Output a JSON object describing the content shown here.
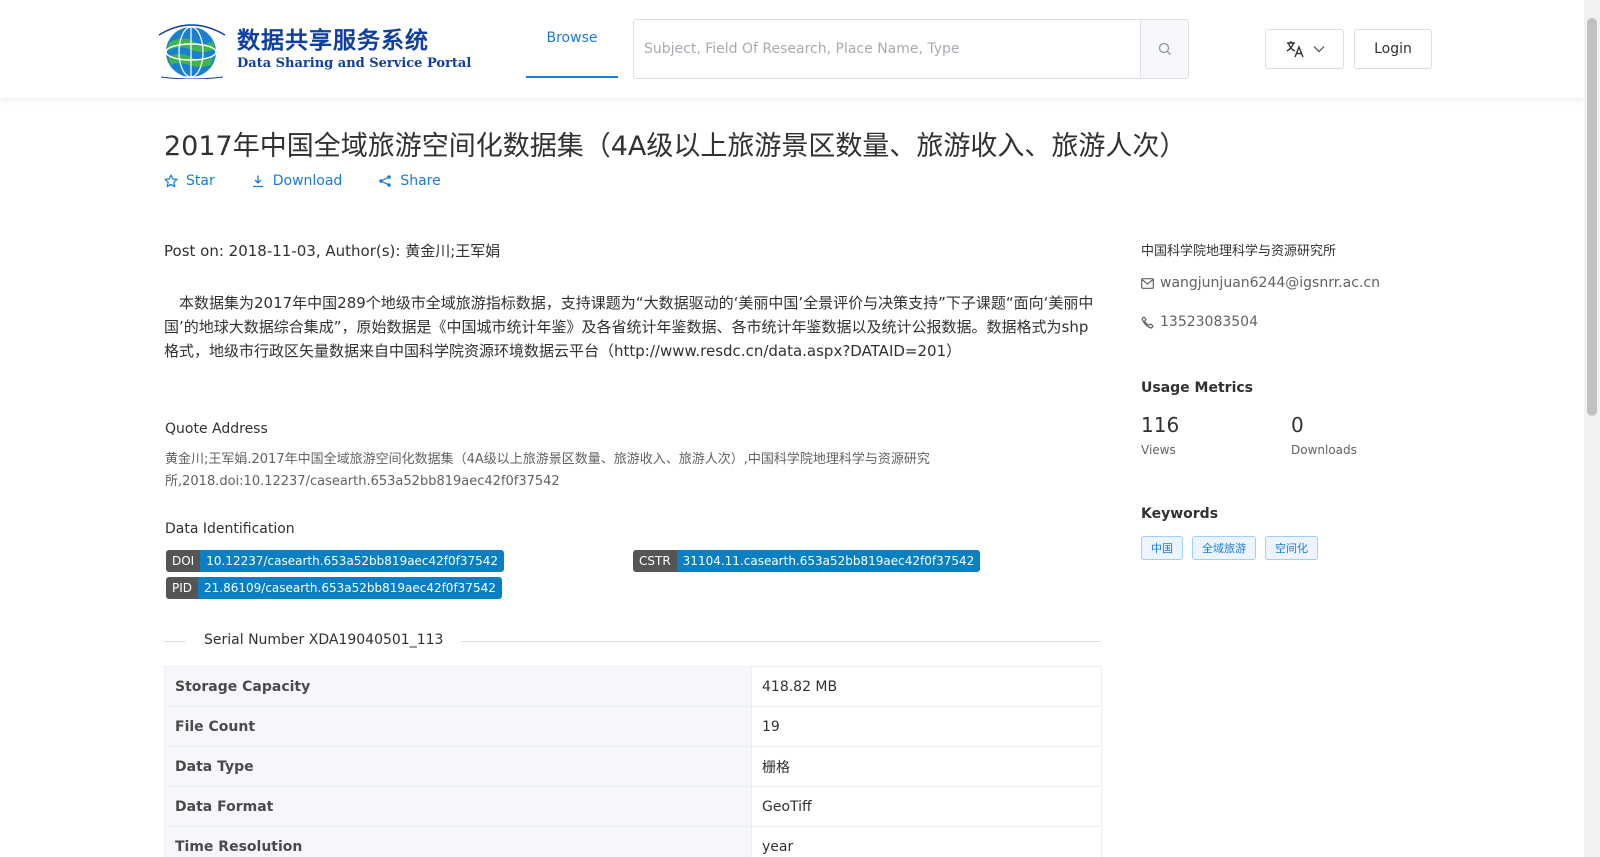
{
  "header": {
    "logo_cn": "数据共享服务系统",
    "logo_en": "Data Sharing and Service Portal",
    "nav_browse": "Browse",
    "search_placeholder": "Subject, Field Of Research, Place Name, Type",
    "login_label": "Login"
  },
  "dataset": {
    "title": "2017年中国全域旅游空间化数据集（4A级以上旅游景区数量、旅游收入、旅游人次）",
    "actions": {
      "star": "Star",
      "download": "Download",
      "share": "Share"
    },
    "post_on": "Post on: 2018-11-03, Author(s): 黄金川;王军娟",
    "description": "本数据集为2017年中国289个地级市全域旅游指标数据，支持课题为“大数据驱动的‘美丽中国’全景评价与决策支持”下子课题“面向‘美丽中国’的地球大数据综合集成”，原始数据是《中国城市统计年鉴》及各省统计年鉴数据、各市统计年鉴数据以及统计公报数据。数据格式为shp格式，地级市行政区矢量数据来自中国科学院资源环境数据云平台（http://www.resdc.cn/data.aspx?DATAID=201）",
    "quote_label": "Quote Address",
    "quote_text": "黄金川;王军娟.2017年中国全域旅游空间化数据集（4A级以上旅游景区数量、旅游收入、旅游人次）,中国科学院地理科学与资源研究所,2018.doi:10.12237/casearth.653a52bb819aec42f0f37542",
    "identification_label": "Data Identification",
    "identifiers": {
      "doi": {
        "key": "DOI",
        "value": "10.12237/casearth.653a52bb819aec42f0f37542"
      },
      "cstr": {
        "key": "CSTR",
        "value": "31104.11.casearth.653a52bb819aec42f0f37542"
      },
      "pid": {
        "key": "PID",
        "value": "21.86109/casearth.653a52bb819aec42f0f37542"
      }
    },
    "serial_number": "Serial Number XDA19040501_113",
    "properties": [
      {
        "key": "Storage Capacity",
        "value": "418.82 MB"
      },
      {
        "key": "File Count",
        "value": "19"
      },
      {
        "key": "Data Type",
        "value": "栅格"
      },
      {
        "key": "Data Format",
        "value": "GeoTiff"
      },
      {
        "key": "Time Resolution",
        "value": "year"
      }
    ]
  },
  "sidebar": {
    "organization": "中国科学院地理科学与资源研究所",
    "email": "wangjunjuan6244@igsnrr.ac.cn",
    "phone": "13523083504",
    "usage_title": "Usage Metrics",
    "views_count": "116",
    "views_label": "Views",
    "downloads_count": "0",
    "downloads_label": "Downloads",
    "keywords_title": "Keywords",
    "keywords": [
      "中国",
      "全域旅游",
      "空间化"
    ]
  },
  "colors": {
    "accent": "#1a7bd6",
    "badge_value": "#0b7fc4",
    "badge_key": "#555555"
  }
}
